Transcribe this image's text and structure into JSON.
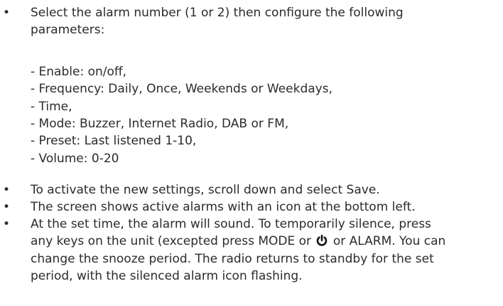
{
  "bullet_symbol": "•",
  "first": {
    "line1": "Select the alarm number (1 or 2) then configure the following",
    "line2": "parameters:"
  },
  "parameters": [
    "- Enable: on/off,",
    "- Frequency: Daily, Once, Weekends or Weekdays,",
    "- Time,",
    "- Mode: Buzzer, Internet Radio, DAB or FM,",
    "- Preset: Last listened 1-10,",
    "- Volume: 0-20"
  ],
  "bullets": [
    "To activate the new settings, scroll down and select Save.",
    "The screen shows active alarms with an icon at the bottom left."
  ],
  "last": {
    "line1": "At the set time, the alarm will sound. To temporarily silence, press",
    "line2_a": "any keys on the unit (excepted press MODE or",
    "line2_icon": "power-icon",
    "line2_b": "or ALARM. You can",
    "line3": "change the snooze period. The radio returns to standby for the set",
    "line4": "period, with the silenced alarm icon flashing."
  }
}
